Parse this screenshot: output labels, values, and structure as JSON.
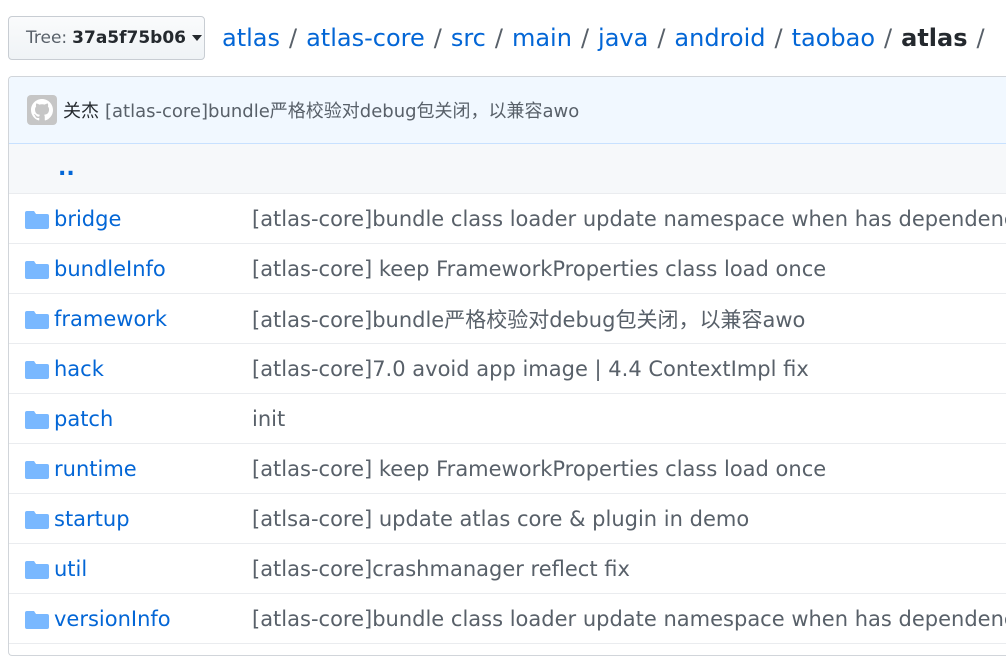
{
  "tree_button": {
    "label": "Tree:",
    "sha": "37a5f75b06"
  },
  "breadcrumb": {
    "parts": [
      "atlas",
      "atlas-core",
      "src",
      "main",
      "java",
      "android",
      "taobao"
    ],
    "current": "atlas",
    "separator": "/"
  },
  "latest_commit": {
    "author": "关杰",
    "message": "[atlas-core]bundle严格校验对debug包关闭，以兼容awo"
  },
  "up_link": "..",
  "files": [
    {
      "name": "bridge",
      "message": "[atlas-core]bundle class loader update namespace when has dependencies"
    },
    {
      "name": "bundleInfo",
      "message": "[atlas-core] keep FrameworkProperties class load once"
    },
    {
      "name": "framework",
      "message": "[atlas-core]bundle严格校验对debug包关闭，以兼容awo"
    },
    {
      "name": "hack",
      "message": "[atlas-core]7.0 avoid app image | 4.4 ContextImpl fix"
    },
    {
      "name": "patch",
      "message": "init"
    },
    {
      "name": "runtime",
      "message": "[atlas-core] keep FrameworkProperties class load once"
    },
    {
      "name": "startup",
      "message": "[atlsa-core] update atlas core & plugin in demo"
    },
    {
      "name": "util",
      "message": "[atlas-core]crashmanager reflect fix"
    },
    {
      "name": "versionInfo",
      "message": "[atlas-core]bundle class loader update namespace when has dependencies"
    }
  ],
  "colors": {
    "link": "#0366d6",
    "folder": "#79b8ff",
    "commit_bg": "#f1f8ff"
  },
  "icons": {
    "folder": "folder-icon",
    "avatar": "github-avatar-icon",
    "caret": "caret-down-icon"
  }
}
